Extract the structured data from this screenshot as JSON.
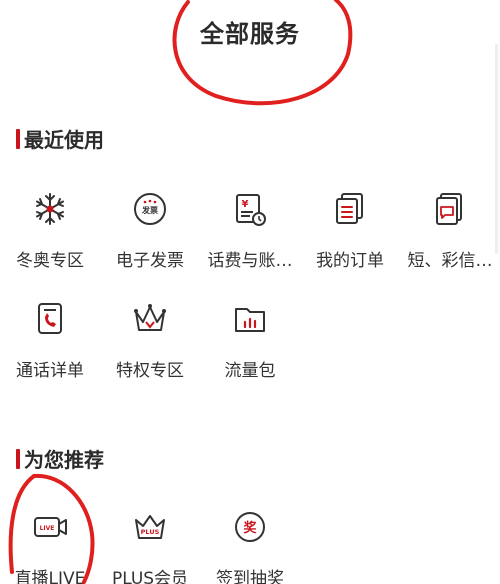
{
  "page": {
    "title": "全部服务"
  },
  "colors": {
    "accent": "#c9161d",
    "icon_stroke": "#333333",
    "annotation": "#e0201e"
  },
  "recent": {
    "title": "最近使用",
    "items": [
      {
        "label": "冬奥专区",
        "icon": "snowflake-icon"
      },
      {
        "label": "电子发票",
        "icon": "invoice-icon",
        "icon_text": "发票"
      },
      {
        "label": "话费与账…",
        "icon": "bill-icon"
      },
      {
        "label": "我的订单",
        "icon": "orders-icon"
      },
      {
        "label": "短、彩信…",
        "icon": "message-record-icon"
      },
      {
        "label": "通话详单",
        "icon": "call-record-icon"
      },
      {
        "label": "特权专区",
        "icon": "crown-icon"
      },
      {
        "label": "流量包",
        "icon": "data-folder-icon"
      }
    ]
  },
  "recommend": {
    "title": "为您推荐",
    "items": [
      {
        "label": "直播LIVE",
        "icon": "live-camera-icon",
        "icon_text": "LIVE"
      },
      {
        "label": "PLUS会员",
        "icon": "plus-crown-icon",
        "icon_text": "PLUS"
      },
      {
        "label": "签到抽奖",
        "icon": "lottery-icon",
        "icon_text": "奖"
      }
    ]
  }
}
